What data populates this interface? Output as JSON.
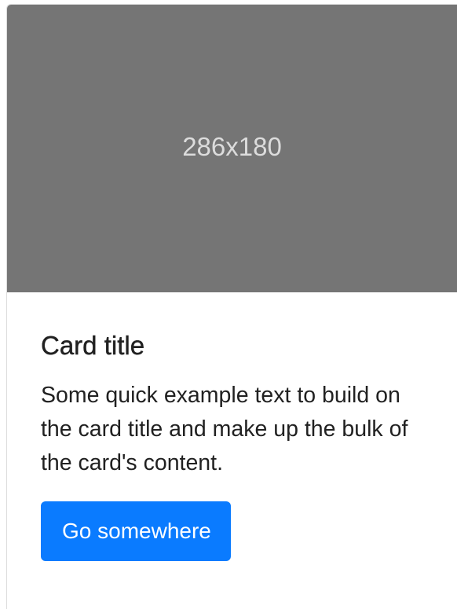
{
  "card": {
    "image_placeholder_text": "286x180",
    "title": "Card title",
    "text": "Some quick example text to build on the card title and make up the bulk of the card's content.",
    "button_label": "Go somewhere",
    "colors": {
      "image_bg": "#757575",
      "button_bg": "#0a7bff",
      "text": "#212121"
    }
  }
}
